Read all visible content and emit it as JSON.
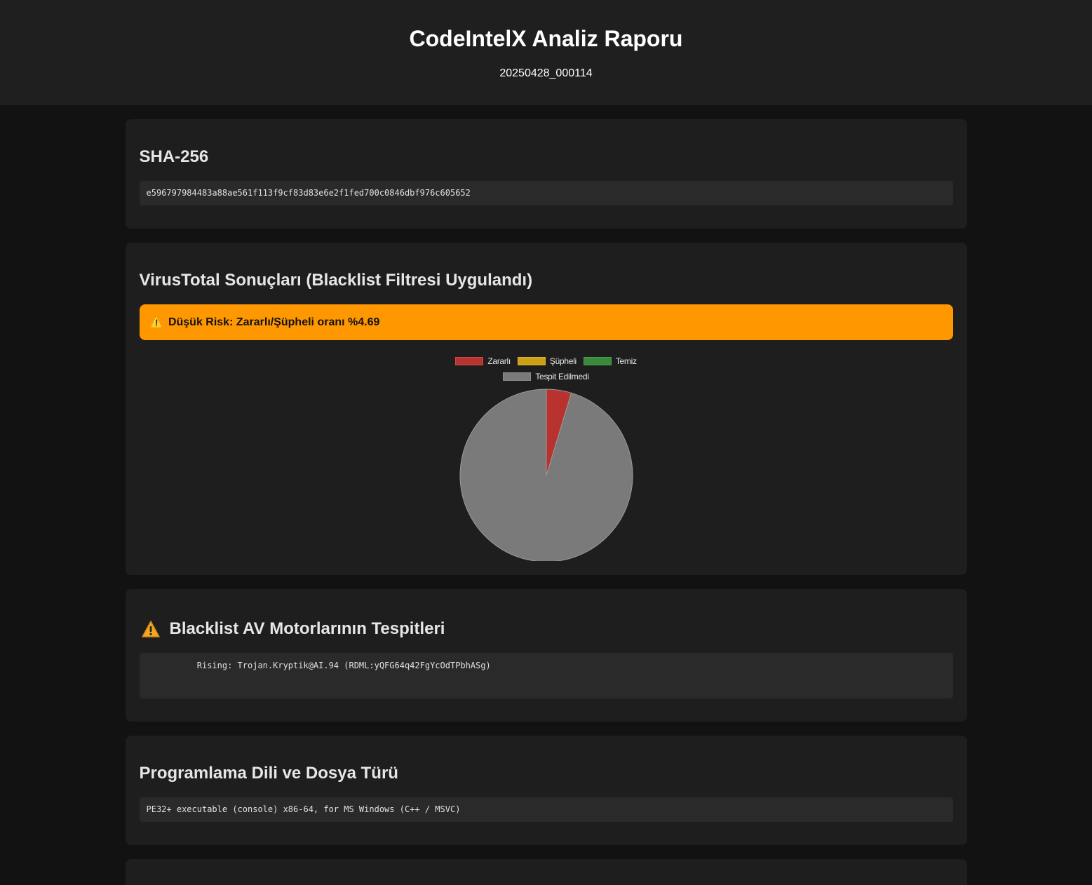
{
  "header": {
    "title": "CodeIntelX Analiz Raporu",
    "subtitle": "20250428_000114"
  },
  "sha": {
    "heading": "SHA-256",
    "value": "e596797984483a88ae561f113f9cf83d83e6e2f1fed700c0846dbf976c605652"
  },
  "virustotal": {
    "heading": "VirusTotal Sonuçları (Blacklist Filtresi Uygulandı)",
    "alert_icon": "warning-icon",
    "alert_text": "Düşük Risk: Zararlı/Şüpheli oranı %4.69",
    "alert_color": "#ff9800"
  },
  "chart_data": {
    "type": "pie",
    "categories": [
      "Zararlı",
      "Şüpheli",
      "Temiz",
      "Tespit Edilmedi"
    ],
    "values": [
      3,
      0,
      0,
      61
    ],
    "colors": [
      "#b83330",
      "#c9a018",
      "#3a8a3e",
      "#7a7a7a"
    ],
    "legend_position": "top"
  },
  "blacklist": {
    "heading_icon": "warning-icon",
    "heading": "Blacklist AV Motorlarının Tespitleri",
    "entries": "          Rising: Trojan.Kryptik@AI.94 (RDML:yQFG64q42FgYcOdTPbhASg)"
  },
  "filetype": {
    "heading": "Programlama Dili ve Dosya Türü",
    "value": "PE32+ executable (console) x86-64, for MS Windows (C++ / MSVC)"
  }
}
